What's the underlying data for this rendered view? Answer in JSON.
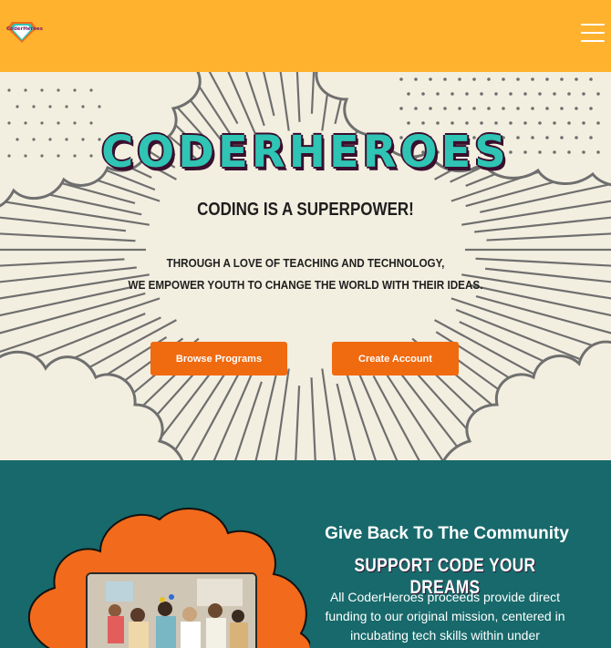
{
  "header": {
    "logo_text": "CoderHeroes",
    "menu_icon": "hamburger-menu-icon",
    "bg_color": "#ffb22e"
  },
  "hero": {
    "title": "CODERHEROES",
    "tagline": "CODING IS A SUPERPOWER!",
    "description_line1": "THROUGH A LOVE OF TEACHING AND TECHNOLOGY,",
    "description_line2": "WE EMPOWER YOUTH TO CHANGE THE WORLD WITH THEIR IDEAS.",
    "browse_button": "Browse Programs",
    "create_button": "Create Account",
    "accent_color": "#f06a10",
    "title_color": "#2fc4b4"
  },
  "community": {
    "heading": "Give Back To The Community",
    "subheading": "SUPPORT CODE YOUR DREAMS",
    "body": "All CoderHeroes proceeds provide direct funding to our original mission, centered in incubating tech skills within under",
    "bg_color": "#17696b",
    "cloud_color": "#f26a1b"
  }
}
